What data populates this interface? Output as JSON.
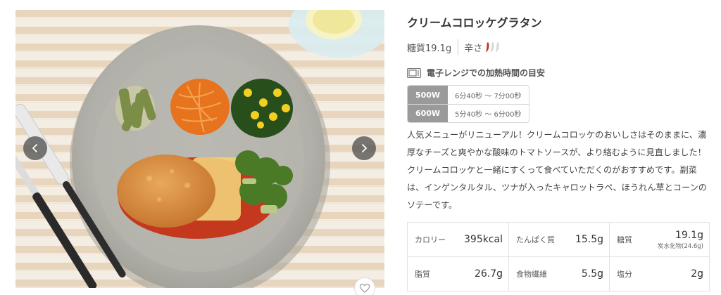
{
  "product": {
    "title": "クリームコロッケグラタン",
    "sugar": "糖質19.1g",
    "spice_label": "辛さ",
    "spice_level": 1,
    "spice_max": 3,
    "colors": {
      "pepper_on": "#c0392b",
      "pepper_off": "#d5d5d5",
      "watt_bg": "#9a9a9a"
    }
  },
  "heating": {
    "title": "電子レンジでの加熱時間の目安",
    "rows": [
      {
        "watt": "500W",
        "time": "6分40秒 ～ 7分00秒"
      },
      {
        "watt": "600W",
        "time": "5分40秒 ～ 6分00秒"
      }
    ]
  },
  "description": "人気メニューがリニューアル！クリームコロッケのおいしさはそのままに、濃厚なチーズと爽やかな酸味のトマトソースが、より絡むように見直しました！クリームコロッケと一緒にすくって食べていただくのがおすすめです。副菜は、インゲンタルタル、ツナが入ったキャロットラペ、ほうれん草とコーンのソテーです。",
  "nutrition": {
    "rows": [
      [
        {
          "label": "カロリー",
          "value": "395kcal"
        },
        {
          "label": "たんぱく質",
          "value": "15.5g"
        },
        {
          "label": "糖質",
          "value": "19.1g",
          "sub": "炭水化物(24.6g)"
        }
      ],
      [
        {
          "label": "脂質",
          "value": "26.7g"
        },
        {
          "label": "食物繊維",
          "value": "5.5g"
        },
        {
          "label": "塩分",
          "value": "2g"
        }
      ]
    ]
  },
  "photo": {
    "icons": {
      "prev": "chevron-left-icon",
      "next": "chevron-right-icon",
      "favorite": "heart-icon"
    }
  }
}
